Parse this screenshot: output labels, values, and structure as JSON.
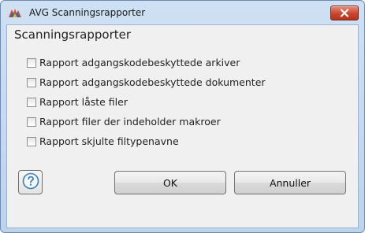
{
  "window": {
    "title": "AVG Scanningsrapporter",
    "icon": "avg-logo-icon",
    "close_icon": "close-icon"
  },
  "dialog": {
    "heading": "Scanningsrapporter",
    "options": [
      {
        "label": "Rapport adgangskodebeskyttede arkiver",
        "checked": false
      },
      {
        "label": "Rapport adgangskodebeskyttede dokumenter",
        "checked": false
      },
      {
        "label": "Rapport låste filer",
        "checked": false
      },
      {
        "label": "Rapport filer der indeholder makroer",
        "checked": false
      },
      {
        "label": "Rapport skjulte filtypenavne",
        "checked": false
      }
    ]
  },
  "buttons": {
    "help_icon": "help-icon",
    "ok": "OK",
    "cancel": "Annuller"
  },
  "colors": {
    "frame": "#bcd3ec",
    "client": "#f0f0f0",
    "close": "#c9452d",
    "help_icon": "#3b7fb8"
  }
}
